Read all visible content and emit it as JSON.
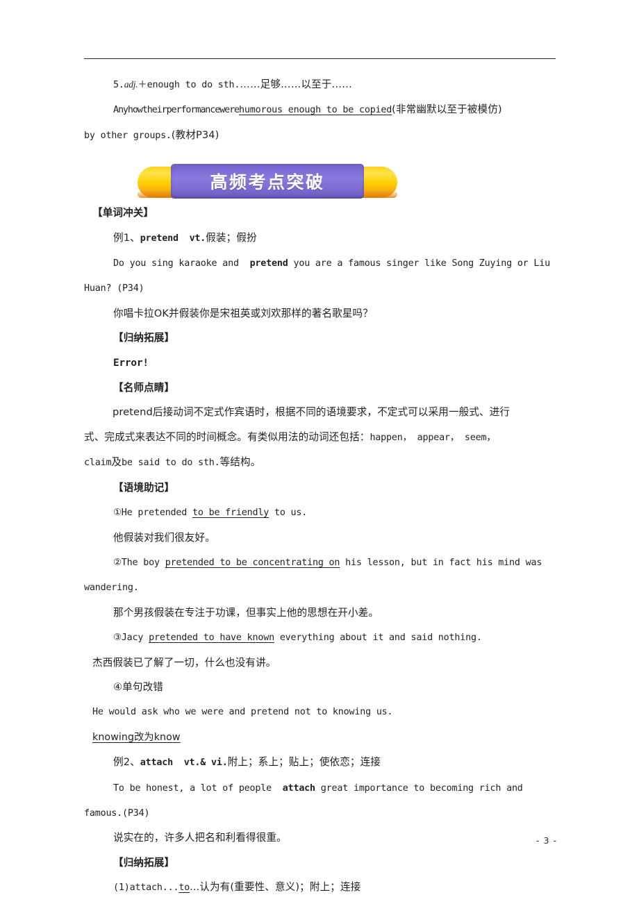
{
  "document": {
    "page_number": "- 3 -",
    "banner": {
      "label": "高频考点突破",
      "center_color": "#7b6ad2",
      "cap_color": "#ffd000",
      "cap_shadow_color": "#e8880d",
      "text_color": "#ffffff"
    }
  },
  "body": {
    "item5": {
      "number": "5.",
      "pattern_italic": "adj.",
      "pattern_rest": "＋enough to do sth.",
      "gloss": "……足够……以至于……",
      "example_run_on": "Anyhowtheirperformancewere",
      "example_underlined": "humorous enough to be copied",
      "example_paren": "(非常幽默以至于被模仿)",
      "example_tail": "by other groups.",
      "example_source": "(教材P34)"
    },
    "section_word_drill": "【单词冲关】",
    "entry1": {
      "label": "例1、",
      "headword": "pretend",
      "pos": "vt.",
      "meaning": "假装；假扮",
      "sentence_pre": "Do you sing karaoke and",
      "sentence_bold": "pretend",
      "sentence_post": "you are a famous singer like Song Zuying or Liu",
      "sentence_wrap": "Huan?",
      "sentence_source": "(P34)",
      "translation": "你唱卡拉OK并假装你是宋祖英或刘欢那样的著名歌星吗？",
      "section_summary": "【归纳拓展】",
      "error_text": "Error!",
      "section_tip": "【名师点睛】",
      "tip_line1": "pretend后接动词不定式作宾语时，根据不同的语境要求，不定式可以采用一般式、进行",
      "tip_line2_cn": "式、完成式来表达不同的时间概念。有类似用法的动词还包括：",
      "tip_line2_en": "happen， appear， seem，",
      "tip_line3_en": "claim",
      "tip_line3_cn_a": "及",
      "tip_line3_en_b": "be said to do sth.",
      "tip_line3_cn_b": "等结构。",
      "section_context": "【语境助记】",
      "ex1_pre": "①He pretended ",
      "ex1_underline": "to be friendly",
      "ex1_post": " to us.",
      "ex1_cn": "他假装对我们很友好。",
      "ex2_pre": "②The boy ",
      "ex2_underline": "pretended to be concentrating on",
      "ex2_post": " his lesson, but in fact his mind was",
      "ex2_wrap": "wandering.",
      "ex2_cn": "那个男孩假装在专注于功课，但事实上他的思想在开小差。",
      "ex3_pre": "③Jacy ",
      "ex3_underline": "pretended to have known",
      "ex3_post": " everything about it and said nothing.",
      "ex3_cn": "杰西假装已了解了一切，什么也没有讲。",
      "ex4_label": "④单句改错",
      "ex4_sentence": "He would ask who we were and pretend not to knowing us.",
      "ex4_answer": "knowing改为know"
    },
    "entry2": {
      "label": "例2、",
      "headword": "attach",
      "pos": "vt.& vi.",
      "meaning": "附上；系上；贴上；使依恋；连接",
      "sentence_pre": "To be honest, a lot of people",
      "sentence_bold": "attach",
      "sentence_post": "great importance to becoming rich and",
      "sentence_wrap": "famous.",
      "sentence_source": "(P34)",
      "translation": "说实在的，许多人把名和利看得很重。",
      "section_summary": "【归纳拓展】",
      "point1_pre": "(1)attach...",
      "point1_underline": "to",
      "point1_post": "...认为有(重要性、意义)；附上；连接"
    }
  }
}
